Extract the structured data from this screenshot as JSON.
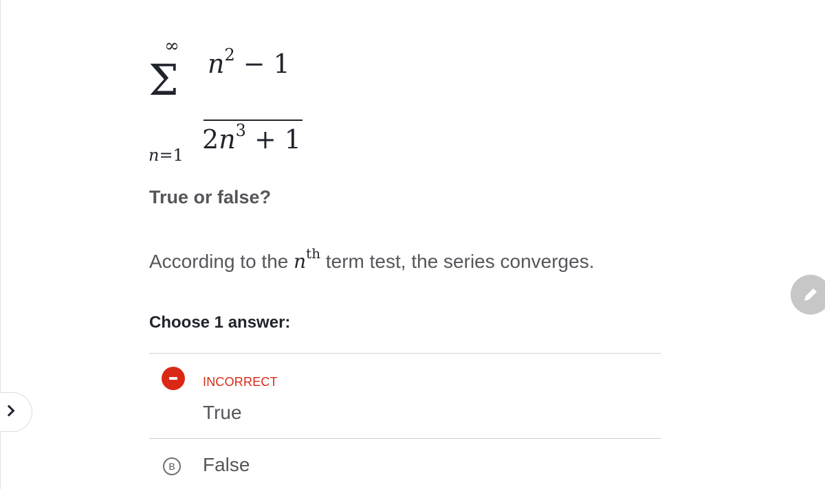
{
  "math": {
    "sum_upper": "∞",
    "sum_symbol": "Σ",
    "sum_lower_var": "n",
    "sum_lower_eq": "=1",
    "numerator_var": "n",
    "numerator_exp": "2",
    "numerator_op": "−",
    "numerator_const": "1",
    "denominator_coef": "2",
    "denominator_var": "n",
    "denominator_exp": "3",
    "denominator_op": "+",
    "denominator_const": "1"
  },
  "question": {
    "heading": "True or false?",
    "statement_pre": "According to the ",
    "statement_var": "n",
    "statement_sup": "th",
    "statement_post": " term test, the series converges.",
    "prompt": "Choose 1 answer:"
  },
  "choices": [
    {
      "status": "INCORRECT",
      "text": "True",
      "selected": true,
      "correct": false
    },
    {
      "letter": "B",
      "text": "False",
      "selected": false
    }
  ],
  "colors": {
    "incorrect": "#d92916",
    "text": "#21242c",
    "muted_text": "#55565a",
    "fab": "#c7c7c7"
  },
  "icons": {
    "side_tab": "chevron-right-icon",
    "fab": "pencil-icon",
    "incorrect": "minus-circle-icon"
  }
}
